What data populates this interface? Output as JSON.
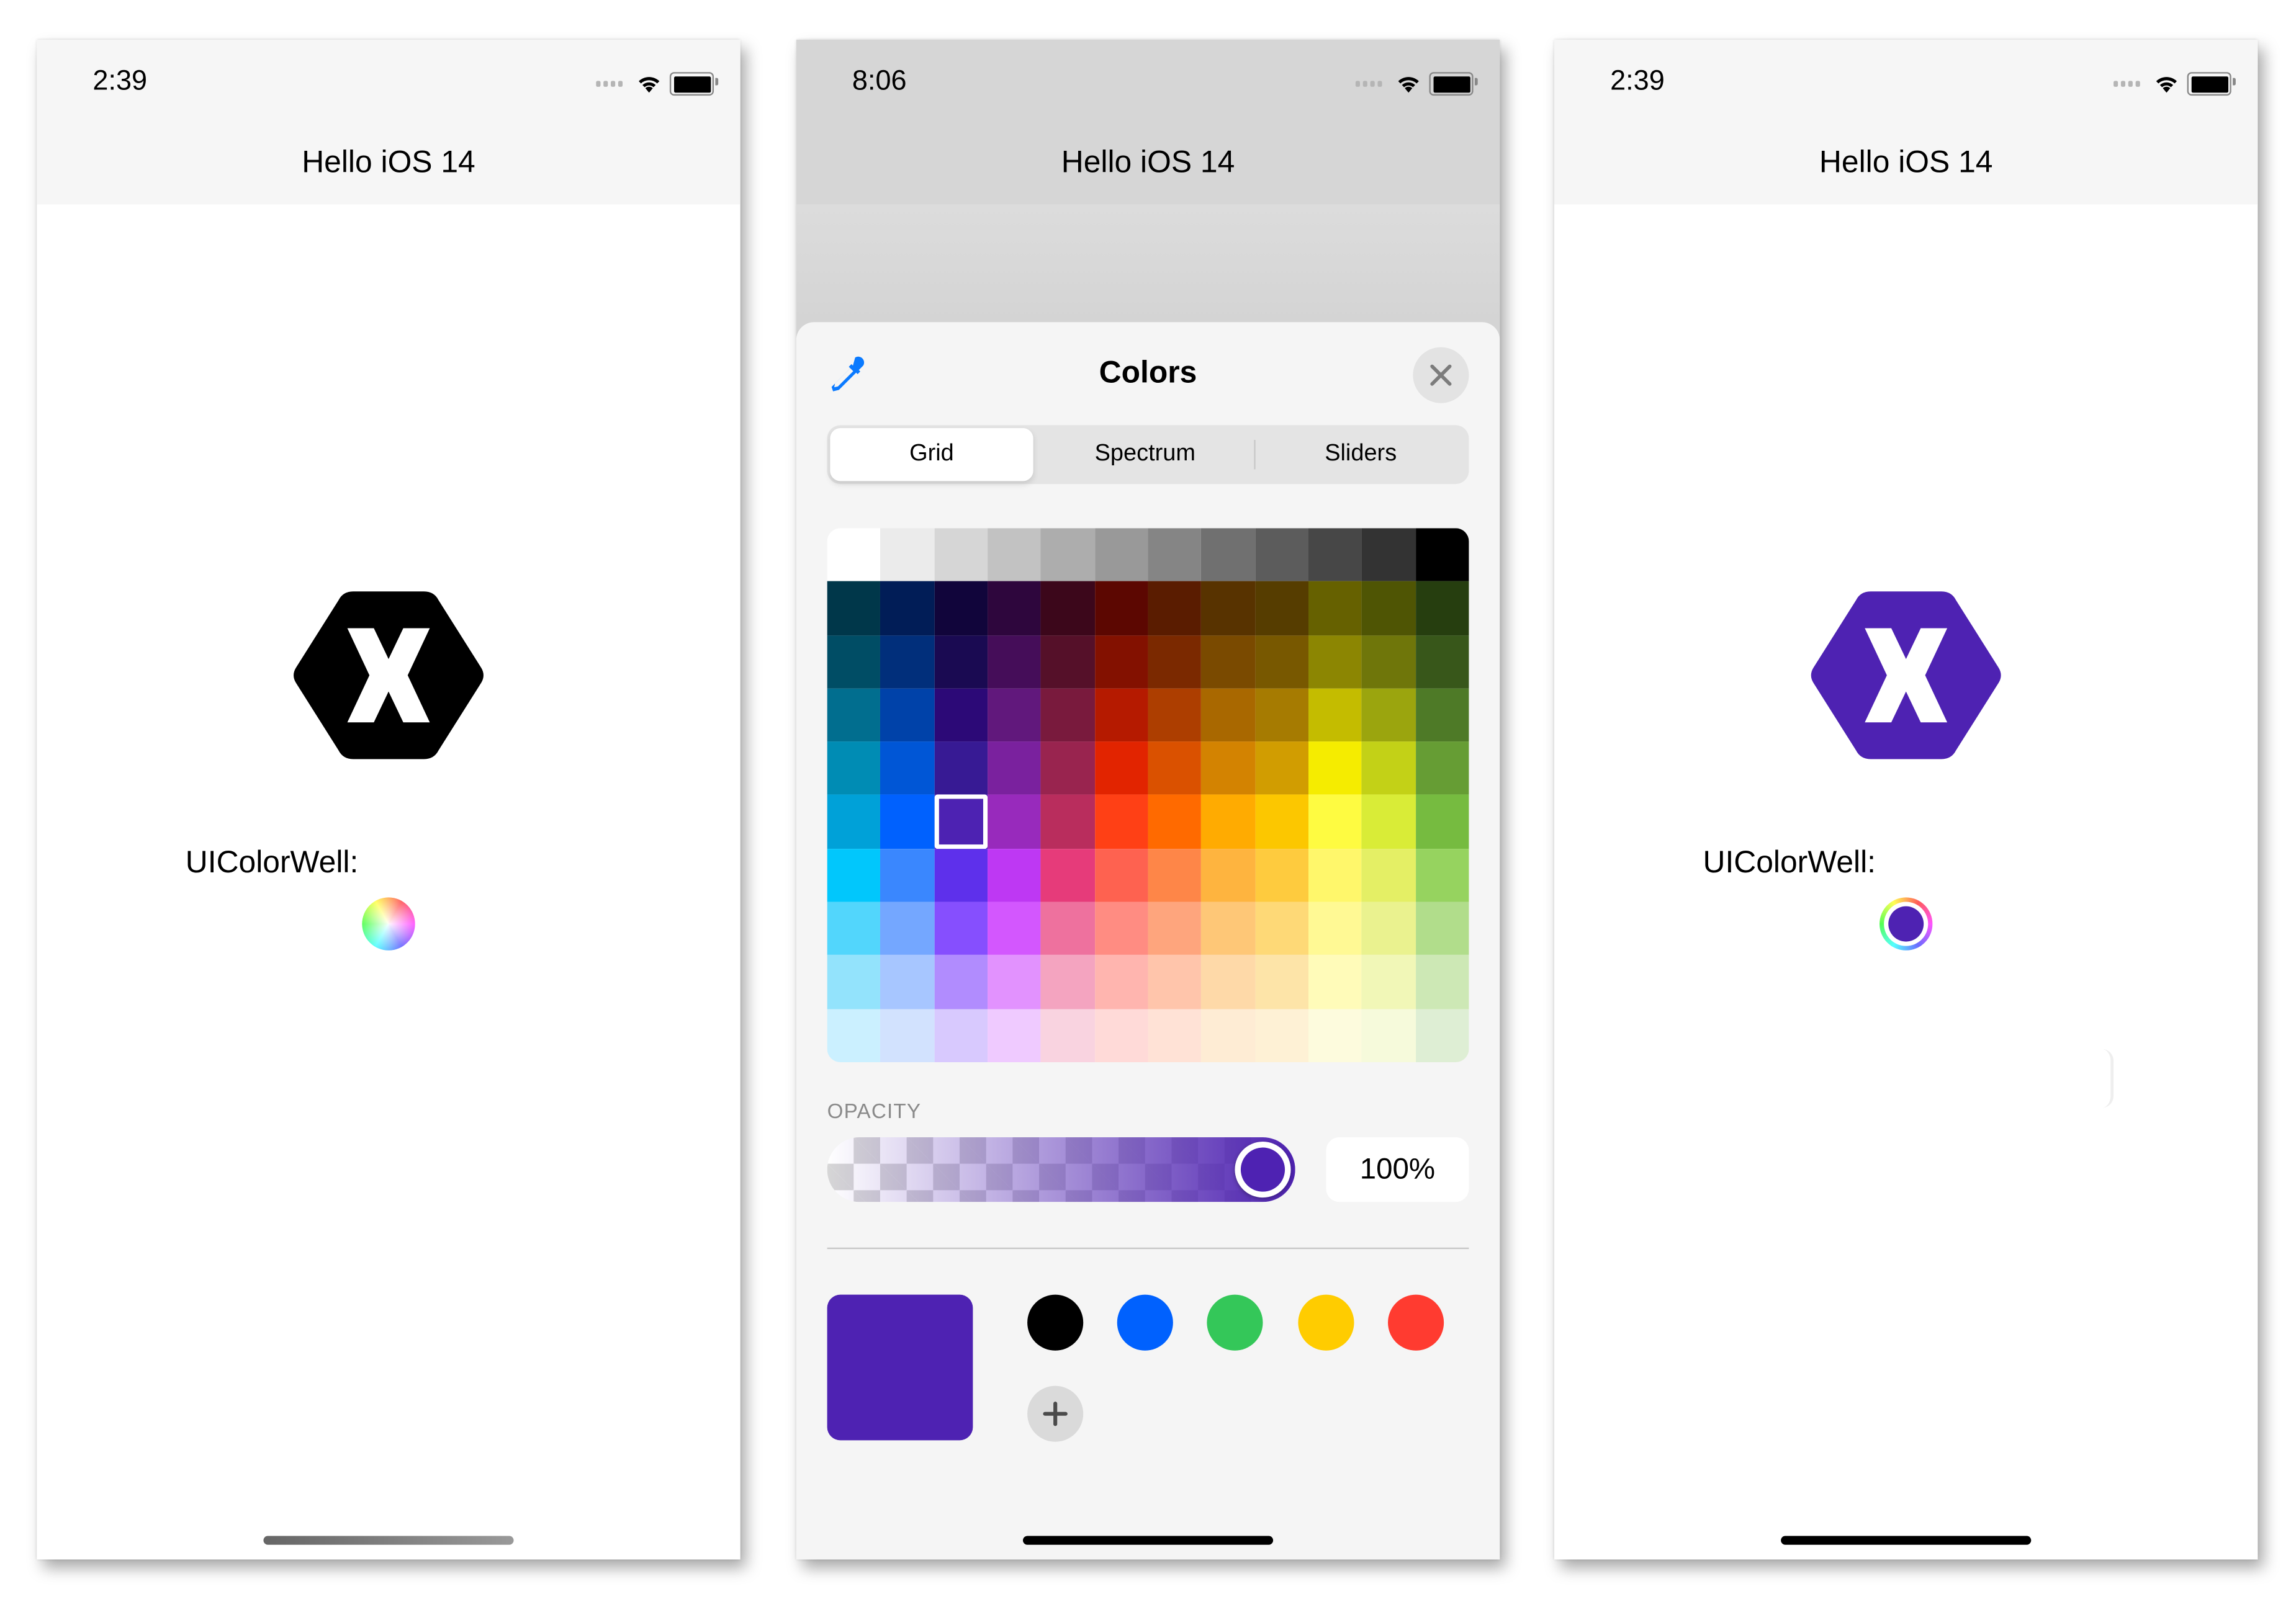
{
  "phones": [
    {
      "status": {
        "time": "2:39"
      },
      "nav_title": "Hello iOS 14",
      "logo_color": "#000000",
      "color_well_label": "UIColorWell:",
      "color_well_state": "empty"
    },
    {
      "status": {
        "time": "8:06"
      },
      "nav_title": "Hello iOS 14",
      "picker": {
        "title": "Colors",
        "close_icon": "close-icon",
        "eyedropper_icon": "eyedropper-icon",
        "tabs": [
          {
            "label": "Grid",
            "selected": true
          },
          {
            "label": "Spectrum",
            "selected": false
          },
          {
            "label": "Sliders",
            "selected": false
          }
        ],
        "grid": {
          "columns": 12,
          "rows": [
            [
              "#ffffff",
              "#ebebeb",
              "#d6d6d6",
              "#c2c2c2",
              "#adadad",
              "#999999",
              "#858585",
              "#707070",
              "#5c5c5c",
              "#474747",
              "#333333",
              "#000000"
            ],
            [
              "#00374a",
              "#011d57",
              "#11053b",
              "#2e063d",
              "#3c071b",
              "#5c0701",
              "#5a1c00",
              "#583300",
              "#563d00",
              "#666100",
              "#4f5504",
              "#263e0f"
            ],
            [
              "#004d65",
              "#012f7b",
              "#1a0a52",
              "#450d59",
              "#551029",
              "#831100",
              "#7b2900",
              "#7a4a00",
              "#785800",
              "#8c8602",
              "#6f760a",
              "#38571a"
            ],
            [
              "#016e8f",
              "#0042a9",
              "#2c0977",
              "#61187c",
              "#791a3d",
              "#b51a00",
              "#ad3e00",
              "#a96800",
              "#a67b01",
              "#c4bc00",
              "#9ba50e",
              "#4e7a27"
            ],
            [
              "#008cb4",
              "#0056d6",
              "#371a94",
              "#7a219e",
              "#99244f",
              "#e22400",
              "#da5100",
              "#d38301",
              "#d19d01",
              "#f5ec00",
              "#c3d117",
              "#669d34"
            ],
            [
              "#00a1d8",
              "#0061fe",
              "#4d22b2",
              "#982abc",
              "#b92d5d",
              "#ff4015",
              "#ff6a00",
              "#ffab01",
              "#fcc700",
              "#fefb41",
              "#d9ec37",
              "#76bb40"
            ],
            [
              "#01c7fc",
              "#3a87fe",
              "#5e30eb",
              "#be38f3",
              "#e63b7a",
              "#fe6250",
              "#fe8648",
              "#feb43f",
              "#fecb3e",
              "#fff76b",
              "#e4ef65",
              "#96d35f"
            ],
            [
              "#52d6fc",
              "#74a7ff",
              "#864ffe",
              "#d357fe",
              "#ee719e",
              "#ff8c82",
              "#fea57d",
              "#fec777",
              "#fed977",
              "#fff994",
              "#eaf28f",
              "#b1dd8b"
            ],
            [
              "#93e3fc",
              "#a7c6ff",
              "#b18cfe",
              "#e292fe",
              "#f4a4c0",
              "#ffb5af",
              "#ffc5ab",
              "#fed9a8",
              "#fde4a8",
              "#fffbb9",
              "#f1f7b7",
              "#cde8b5"
            ],
            [
              "#cbf0ff",
              "#d2e2fe",
              "#d8c9fe",
              "#efcaff",
              "#f9d3e0",
              "#ffdad8",
              "#ffe2d6",
              "#feecd4",
              "#fef1d5",
              "#fdfbdd",
              "#f6fadb",
              "#deeed4"
            ]
          ],
          "selected": {
            "row": 5,
            "col": 2
          }
        },
        "opacity": {
          "label": "OPACITY",
          "value": 1.0,
          "display": "100%"
        },
        "current_color": "#4e22b2",
        "favorites": [
          "#000000",
          "#0061fe",
          "#34c759",
          "#ffcc00",
          "#ff3b30"
        ],
        "add_icon": "plus-icon"
      }
    },
    {
      "status": {
        "time": "2:39"
      },
      "nav_title": "Hello iOS 14",
      "logo_color": "#4e22b2",
      "color_well_label": "UIColorWell:",
      "color_well_state": "selected",
      "color_well_color": "#4e22b2"
    }
  ]
}
